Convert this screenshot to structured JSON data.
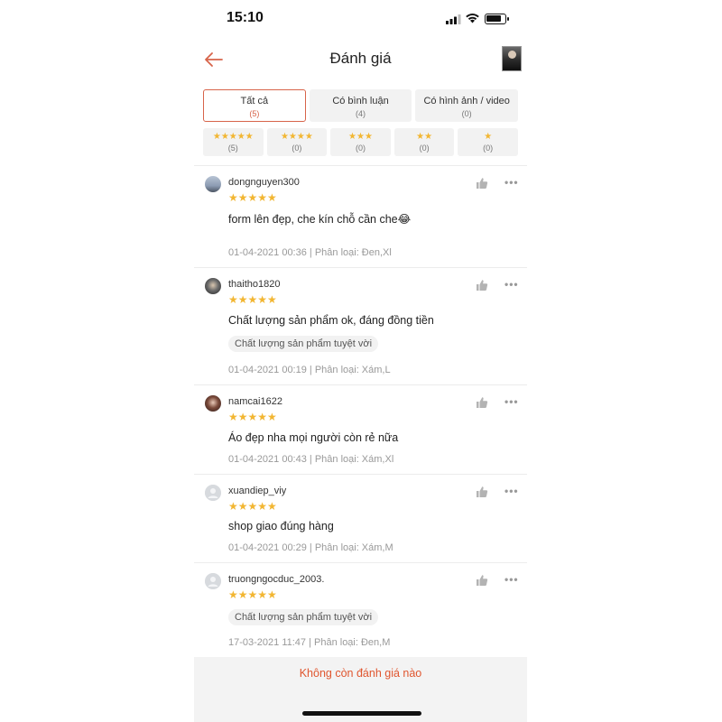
{
  "status_bar": {
    "time": "15:10"
  },
  "header": {
    "title": "Đánh giá"
  },
  "filters": [
    {
      "label": "Tất cả",
      "count": "(5)"
    },
    {
      "label": "Có bình luận",
      "count": "(4)"
    },
    {
      "label": "Có hình ảnh / video",
      "count": "(0)"
    }
  ],
  "star_filters": [
    {
      "stars": "★★★★★",
      "count": "(5)"
    },
    {
      "stars": "★★★★",
      "count": "(0)"
    },
    {
      "stars": "★★★",
      "count": "(0)"
    },
    {
      "stars": "★★",
      "count": "(0)"
    },
    {
      "stars": "★",
      "count": "(0)"
    }
  ],
  "reviews": [
    {
      "user": "dongnguyen300",
      "stars": "★★★★★",
      "rating": 5,
      "text": "form lên đẹp, che kín chỗ cần che😂",
      "tag": "",
      "meta": "01-04-2021 00:36 | Phân loại: Đen,Xl"
    },
    {
      "user": "thaitho1820",
      "stars": "★★★★★",
      "rating": 5,
      "text": "Chất lượng sản phẩm ok, đáng đồng tiền",
      "tag": "Chất lượng sản phẩm tuyệt vời",
      "meta": "01-04-2021 00:19 | Phân loại: Xám,L"
    },
    {
      "user": "namcai1622",
      "stars": "★★★★★",
      "rating": 5,
      "text": "Áo đẹp nha mọi người còn rẻ nữa",
      "tag": "",
      "meta": "01-04-2021 00:43 | Phân loại: Xám,Xl"
    },
    {
      "user": "xuandiep_viy",
      "stars": "★★★★★",
      "rating": 5,
      "text": "shop giao đúng hàng",
      "tag": "",
      "meta": "01-04-2021 00:29 | Phân loại: Xám,M"
    },
    {
      "user": "truongngocduc_2003.",
      "stars": "★★★★★",
      "rating": 5,
      "text": "",
      "tag": "Chất lượng sản phẩm tuyệt vời",
      "meta": "17-03-2021 11:47 | Phân loại: Đen,M"
    }
  ],
  "footer": {
    "message": "Không còn đánh giá nào"
  },
  "colors": {
    "accent": "#d7644a",
    "star": "#f2b632",
    "footer_text": "#e0562f"
  }
}
